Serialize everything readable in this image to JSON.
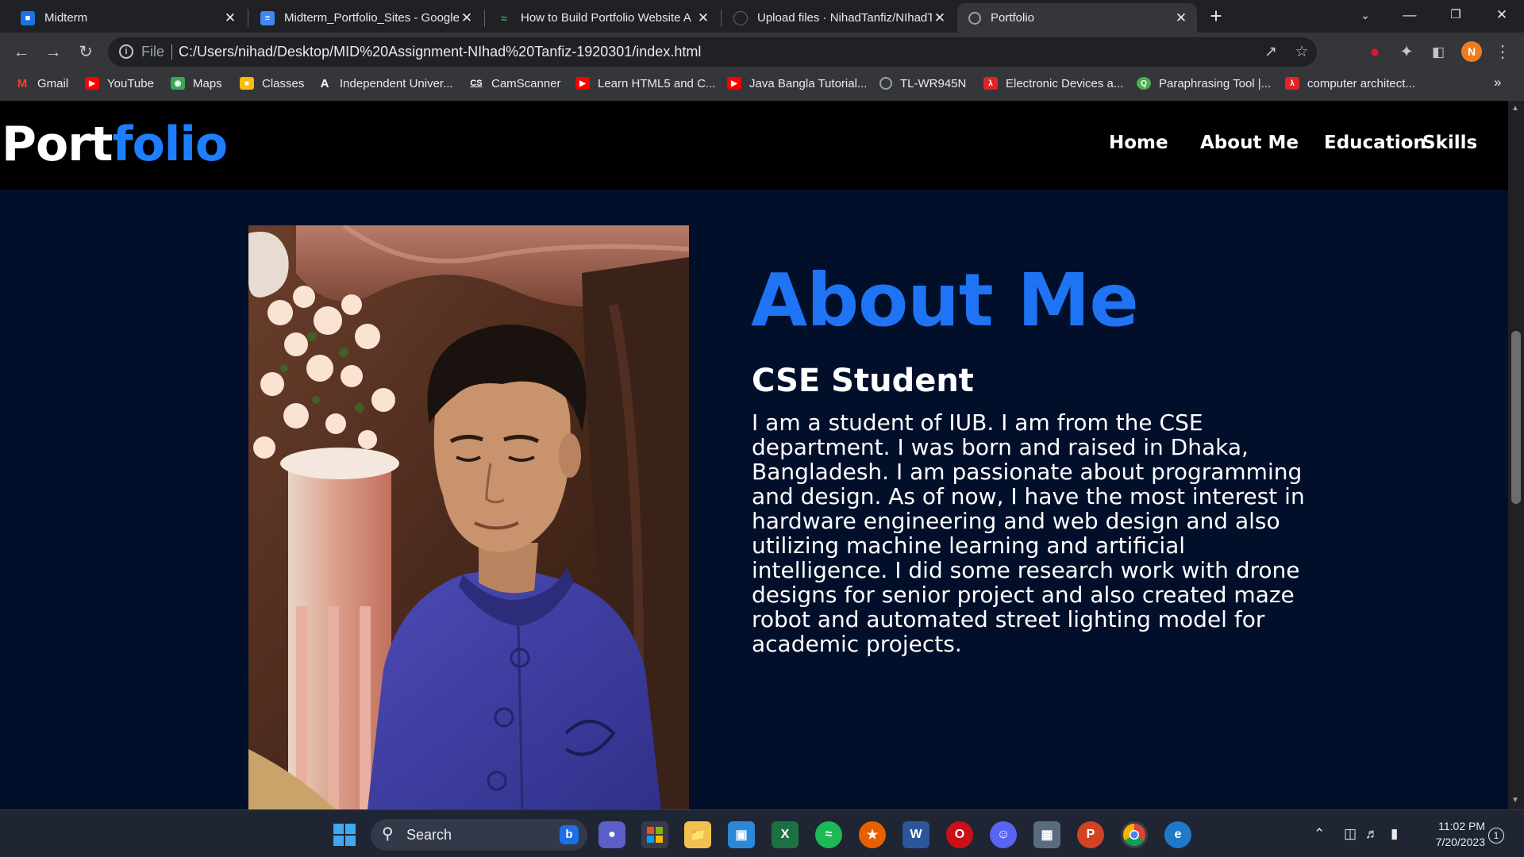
{
  "tabs": [
    {
      "title": "Midterm",
      "icon": "google-classroom-icon",
      "color": "#4285f4"
    },
    {
      "title": "Midterm_Portfolio_Sites - Google",
      "icon": "google-docs-icon",
      "color": "#4285f4"
    },
    {
      "title": "How to Build Portfolio Website A",
      "icon": "site-icon",
      "color": "#35a853"
    },
    {
      "title": "Upload files · NihadTanfiz/NIhadT",
      "icon": "github-icon",
      "color": "#202124"
    },
    {
      "title": "Portfolio",
      "icon": "globe-icon",
      "color": "#9aa0a6"
    }
  ],
  "toolbar": {
    "file_label": "File",
    "url": "C:/Users/nihad/Desktop/MID%20Assignment-NIhad%20Tanfiz-1920301/index.html",
    "profile_initial": "N"
  },
  "bookmarks": [
    {
      "label": "Gmail",
      "icon": "gmail-icon",
      "color": "#ea4335"
    },
    {
      "label": "YouTube",
      "icon": "youtube-icon",
      "color": "#ff0000"
    },
    {
      "label": "Maps",
      "icon": "maps-icon",
      "color": "#34a853"
    },
    {
      "label": "Classes",
      "icon": "classroom-icon",
      "color": "#fbbc04"
    },
    {
      "label": "Independent Univer...",
      "icon": "letter-a-icon",
      "color": "#35363a"
    },
    {
      "label": "CamScanner",
      "icon": "camscanner-icon",
      "color": "#35363a"
    },
    {
      "label": "Learn HTML5 and C...",
      "icon": "youtube-icon",
      "color": "#ff0000"
    },
    {
      "label": "Java Bangla Tutorial...",
      "icon": "youtube-icon",
      "color": "#ff0000"
    },
    {
      "label": "TL-WR945N",
      "icon": "globe-icon",
      "color": "#5f6368"
    },
    {
      "label": "Electronic Devices a...",
      "icon": "pdf-icon",
      "color": "#e02424"
    },
    {
      "label": "Paraphrasing Tool |...",
      "icon": "quillbot-icon",
      "color": "#4caf50"
    },
    {
      "label": "computer architect...",
      "icon": "pdf-icon",
      "color": "#e02424"
    }
  ],
  "site": {
    "logo_part1": "Port",
    "logo_part2": "folio",
    "nav": [
      "Home",
      "About Me",
      "Education",
      "Skills"
    ],
    "about_title": "About Me",
    "about_subtitle": "CSE Student",
    "about_body": "I am a student of IUB. I am from the CSE department. I was born and raised in Dhaka, Bangladesh. I am passionate about programming and design. As of now, I have the most interest in hardware engineering and web design and also utilizing machine learning and artificial intelligence. I did some research work with drone designs for senior project and also created maze robot and automated street lighting model for academic projects.",
    "accent": "#1e74f5",
    "background": "#020f2a"
  },
  "taskbar": {
    "search_label": "Search",
    "apps": [
      "start-icon",
      "search",
      "teams-icon",
      "store-icon",
      "file-explorer-icon",
      "remote-desktop-icon",
      "excel-icon",
      "spotify-icon",
      "firefox-icon",
      "word-icon",
      "opera-icon",
      "discord-icon",
      "calendar-app-icon",
      "powerpoint-icon",
      "chrome-icon",
      "edge-icon"
    ],
    "time": "11:02 PM",
    "date": "7/20/2023",
    "notification_count": "1"
  }
}
